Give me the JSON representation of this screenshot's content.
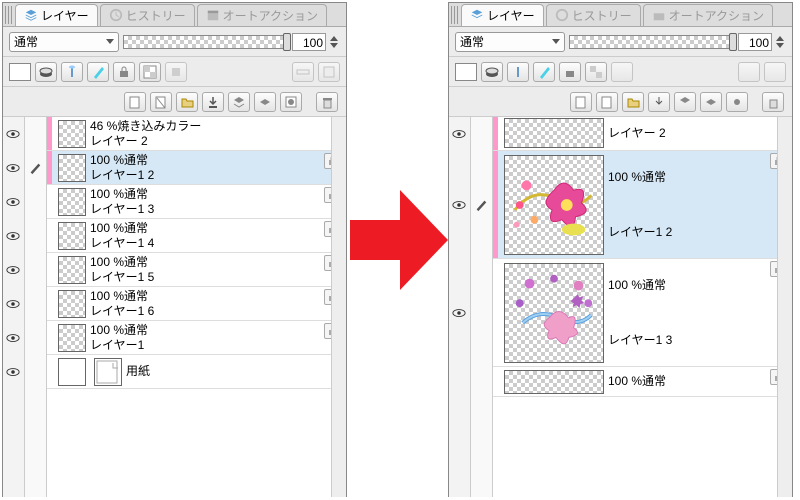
{
  "tabs": {
    "layers": "レイヤー",
    "history": "ヒストリー",
    "autoaction": "オートアクション"
  },
  "blend_mode": "通常",
  "opacity": "100",
  "left_layers": [
    {
      "opacity_label": "46 %焼き込みカラー",
      "name": "レイヤー 2",
      "color": true,
      "selected": false
    },
    {
      "opacity_label": "100 %通常",
      "name": "レイヤー1 2",
      "color": true,
      "selected": true
    },
    {
      "opacity_label": "100 %通常",
      "name": "レイヤー1 3",
      "color": false,
      "selected": false
    },
    {
      "opacity_label": "100 %通常",
      "name": "レイヤー1 4",
      "color": false,
      "selected": false
    },
    {
      "opacity_label": "100 %通常",
      "name": "レイヤー1 5",
      "color": false,
      "selected": false
    },
    {
      "opacity_label": "100 %通常",
      "name": "レイヤー1 6",
      "color": false,
      "selected": false
    },
    {
      "opacity_label": "100 %通常",
      "name": "レイヤー1",
      "color": false,
      "selected": false
    }
  ],
  "left_paper": "用紙",
  "right_layers": [
    {
      "opacity_label": "",
      "name": "レイヤー 2",
      "selected": false,
      "partial": true
    },
    {
      "opacity_label": "100 %通常",
      "name": "レイヤー1 2",
      "selected": true
    },
    {
      "opacity_label": "100 %通常",
      "name": "レイヤー1 3",
      "selected": false
    }
  ],
  "right_bottom_fragment": "100 %通常"
}
